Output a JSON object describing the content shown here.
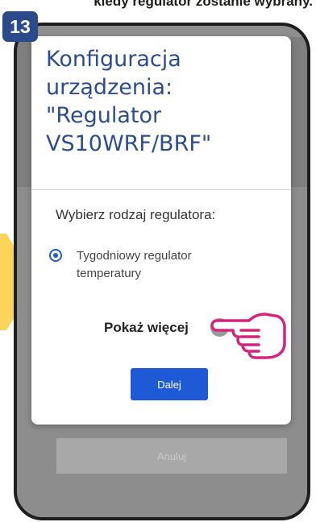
{
  "caption": {
    "text": "kiedy regulator zostanie wybrany."
  },
  "step": {
    "number": "13"
  },
  "dialog": {
    "title": "Konfiguracja urządzenia: \"Regulator VS10WRF/BRF\"",
    "select_label": "Wybierz rodzaj regulatora:",
    "option_label": "Tygodniowy regulator temperatury",
    "option_selected": true,
    "show_more_label": "Pokaż więcej",
    "plus_icon": "plus-circle-icon",
    "next_label": "Dalej"
  },
  "background": {
    "cancel_label": "Anuluj"
  },
  "colors": {
    "title": "#2e4d8f",
    "accent_button": "#1f5ad6",
    "step_badge": "#2b4a8c",
    "arrow": "#fcd45a",
    "hand": "#d4257c",
    "overlay": "#8d8d8d"
  },
  "icons": {
    "pointer": "pointing-hand-icon",
    "arrow": "yellow-arrow-icon"
  }
}
